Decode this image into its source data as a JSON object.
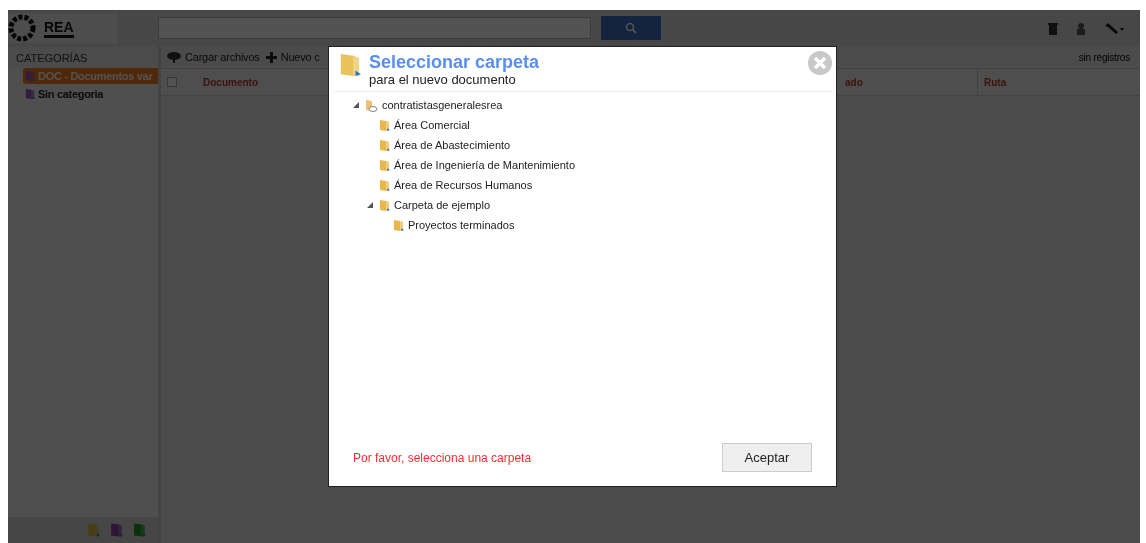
{
  "header": {
    "logo_text": "REA"
  },
  "sidebar": {
    "title": "CATEGORÍAS",
    "items": [
      {
        "label": "DOC - Documentos var",
        "selected": true
      },
      {
        "label": "Sin categoria",
        "selected": false
      }
    ]
  },
  "toolbar": {
    "buttons": [
      "Cargar archivos",
      "Nuevo c"
    ],
    "record_count": "sin registros"
  },
  "table": {
    "select_all_checked": false,
    "columns": [
      "Documento",
      "ado",
      "Ruta"
    ]
  },
  "dialog": {
    "title": "Seleccionar carpeta",
    "subtitle": "para el nuevo documento",
    "tree": [
      {
        "label": "contratistasgeneralesrea",
        "kind": "root",
        "expanded": true,
        "selected": false,
        "children": [
          {
            "label": "Área Comercial",
            "kind": "folder",
            "selected": false
          },
          {
            "label": "Área de Abastecimiento",
            "kind": "folder",
            "selected": false
          },
          {
            "label": "Área de Ingeniería de Mantenimiento",
            "kind": "folder",
            "selected": false
          },
          {
            "label": "Área de Recursos Humanos",
            "kind": "folder",
            "selected": false
          },
          {
            "label": "Carpeta de ejemplo",
            "kind": "folder",
            "expanded": true,
            "selected": false,
            "children": [
              {
                "label": "Proyectos terminados",
                "kind": "folder",
                "selected": false
              }
            ]
          }
        ]
      }
    ],
    "message": "Por favor, selecciona una carpeta",
    "accept_button": "Aceptar"
  }
}
